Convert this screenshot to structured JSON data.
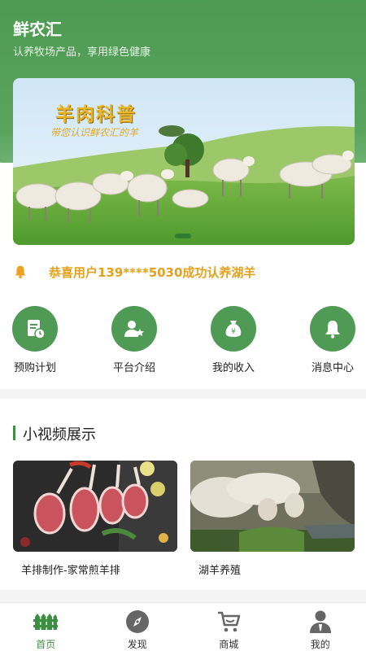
{
  "header": {
    "title": "鲜农汇",
    "subtitle": "认养牧场产品，享用绿色健康"
  },
  "banner": {
    "title": "羊肉科普",
    "subtitle": "带您认识鲜农汇的羊",
    "slides": 1,
    "active_slide": 1
  },
  "notice": {
    "icon": "bell-icon",
    "text": "恭喜用户139****5030成功认养湖羊"
  },
  "menu": [
    {
      "label": "预购计划",
      "icon": "document-clock-icon"
    },
    {
      "label": "平台介绍",
      "icon": "user-star-icon"
    },
    {
      "label": "我的收入",
      "icon": "money-bag-icon"
    },
    {
      "label": "消息中心",
      "icon": "bell-icon"
    }
  ],
  "videos": {
    "section_title": "小视频展示",
    "items": [
      {
        "caption": "羊排制作-家常煎羊排"
      },
      {
        "caption": "湖羊养殖"
      }
    ]
  },
  "tabbar": {
    "active": 0,
    "items": [
      {
        "label": "首页",
        "icon": "farm-fence-icon"
      },
      {
        "label": "发现",
        "icon": "compass-icon"
      },
      {
        "label": "商城",
        "icon": "cart-icon"
      },
      {
        "label": "我的",
        "icon": "user-icon"
      }
    ]
  },
  "colors": {
    "brand_green": "#4f9a55",
    "notice_orange": "#e3a11e",
    "background": "#f4f4f4"
  }
}
